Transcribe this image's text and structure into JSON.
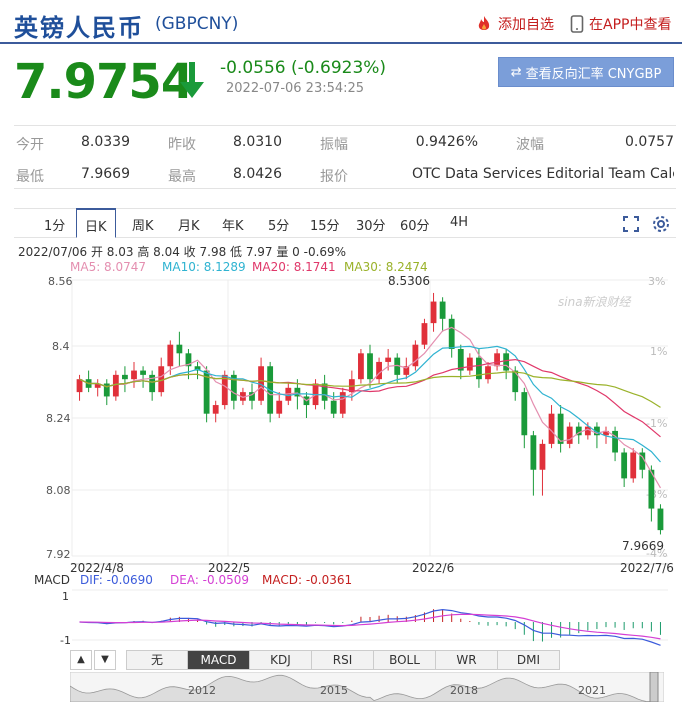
{
  "header": {
    "title": "英镑人民币",
    "code": "(GBPCNY)",
    "add_watch": "添加自选",
    "app_view": "在APP中查看"
  },
  "quote": {
    "price": "7.9754",
    "change": "-0.0556 (-0.6923%)",
    "timestamp": "2022-07-06 23:54:25",
    "reverse_button": "查看反向汇率 CNYGBP"
  },
  "stats": {
    "row1": [
      {
        "label": "今开",
        "value": "8.0339"
      },
      {
        "label": "昨收",
        "value": "8.0310"
      },
      {
        "label": "振幅",
        "value": "0.9426%"
      },
      {
        "label": "波幅",
        "value": "0.0757"
      }
    ],
    "row2": [
      {
        "label": "最低",
        "value": "7.9669"
      },
      {
        "label": "最高",
        "value": "8.0426"
      },
      {
        "label": "报价",
        "value": "OTC Data Services Editorial Team Calc..."
      }
    ]
  },
  "tabs": [
    "1分",
    "日K",
    "周K",
    "月K",
    "年K",
    "5分",
    "15分",
    "30分",
    "60分",
    "4H"
  ],
  "active_tab": "日K",
  "ohlc_line": "2022/07/06 开 8.03 高 8.04 收 7.98 低 7.97 量 0 -0.69%",
  "ma": [
    {
      "label": "MA5: 8.0747",
      "color": "#e48fb0"
    },
    {
      "label": "MA10: 8.1289",
      "color": "#2fb3d1"
    },
    {
      "label": "MA20: 8.1741",
      "color": "#e0386a"
    },
    {
      "label": "MA30: 8.2474",
      "color": "#9ab22a"
    }
  ],
  "watermark": "sina新浪财经",
  "chart_data": {
    "type": "candlestick",
    "y_ticks": [
      "8.56",
      "8.4",
      "8.24",
      "8.08",
      "7.92"
    ],
    "y_pct_ticks": [
      "3%",
      "1%",
      "-1%",
      "-3%",
      "-4%"
    ],
    "x_ticks": [
      "2022/4/8",
      "2022/5",
      "2022/6",
      "2022/7/6"
    ],
    "annotations": {
      "high": "8.5306",
      "low": "7.9669"
    },
    "ylim": [
      7.92,
      8.56
    ],
    "candles": [
      [
        8.3,
        8.33,
        8.28,
        8.34
      ],
      [
        8.33,
        8.31,
        8.3,
        8.35
      ],
      [
        8.31,
        8.32,
        8.29,
        8.33
      ],
      [
        8.32,
        8.29,
        8.27,
        8.33
      ],
      [
        8.29,
        8.34,
        8.28,
        8.35
      ],
      [
        8.34,
        8.33,
        8.3,
        8.36
      ],
      [
        8.33,
        8.35,
        8.31,
        8.37
      ],
      [
        8.35,
        8.34,
        8.31,
        8.36
      ],
      [
        8.34,
        8.3,
        8.28,
        8.35
      ],
      [
        8.3,
        8.36,
        8.29,
        8.38
      ],
      [
        8.36,
        8.41,
        8.34,
        8.42
      ],
      [
        8.41,
        8.39,
        8.36,
        8.44
      ],
      [
        8.39,
        8.36,
        8.33,
        8.4
      ],
      [
        8.36,
        8.35,
        8.33,
        8.37
      ],
      [
        8.35,
        8.25,
        8.23,
        8.36
      ],
      [
        8.25,
        8.27,
        8.23,
        8.28
      ],
      [
        8.27,
        8.34,
        8.26,
        8.35
      ],
      [
        8.34,
        8.28,
        8.26,
        8.35
      ],
      [
        8.28,
        8.3,
        8.27,
        8.31
      ],
      [
        8.3,
        8.28,
        8.26,
        8.32
      ],
      [
        8.28,
        8.36,
        8.27,
        8.38
      ],
      [
        8.36,
        8.25,
        8.23,
        8.37
      ],
      [
        8.25,
        8.28,
        8.24,
        8.3
      ],
      [
        8.28,
        8.31,
        8.27,
        8.32
      ],
      [
        8.31,
        8.29,
        8.26,
        8.33
      ],
      [
        8.29,
        8.27,
        8.24,
        8.3
      ],
      [
        8.27,
        8.32,
        8.26,
        8.33
      ],
      [
        8.32,
        8.28,
        8.26,
        8.34
      ],
      [
        8.28,
        8.25,
        8.24,
        8.3
      ],
      [
        8.25,
        8.3,
        8.24,
        8.31
      ],
      [
        8.3,
        8.33,
        8.28,
        8.35
      ],
      [
        8.33,
        8.39,
        8.32,
        8.4
      ],
      [
        8.39,
        8.33,
        8.31,
        8.41
      ],
      [
        8.33,
        8.37,
        8.32,
        8.38
      ],
      [
        8.37,
        8.38,
        8.35,
        8.4
      ],
      [
        8.38,
        8.34,
        8.32,
        8.39
      ],
      [
        8.34,
        8.36,
        8.33,
        8.38
      ],
      [
        8.36,
        8.41,
        8.35,
        8.42
      ],
      [
        8.41,
        8.46,
        8.4,
        8.47
      ],
      [
        8.46,
        8.51,
        8.44,
        8.53
      ],
      [
        8.51,
        8.47,
        8.44,
        8.52
      ],
      [
        8.47,
        8.4,
        8.38,
        8.48
      ],
      [
        8.4,
        8.35,
        8.33,
        8.41
      ],
      [
        8.35,
        8.38,
        8.34,
        8.39
      ],
      [
        8.38,
        8.33,
        8.31,
        8.4
      ],
      [
        8.33,
        8.36,
        8.32,
        8.37
      ],
      [
        8.36,
        8.39,
        8.35,
        8.4
      ],
      [
        8.39,
        8.35,
        8.33,
        8.4
      ],
      [
        8.35,
        8.3,
        8.28,
        8.36
      ],
      [
        8.3,
        8.2,
        8.17,
        8.31
      ],
      [
        8.2,
        8.12,
        8.06,
        8.21
      ],
      [
        8.12,
        8.18,
        8.06,
        8.19
      ],
      [
        8.18,
        8.25,
        8.17,
        8.27
      ],
      [
        8.25,
        8.18,
        8.16,
        8.27
      ],
      [
        8.18,
        8.22,
        8.17,
        8.23
      ],
      [
        8.22,
        8.2,
        8.18,
        8.23
      ],
      [
        8.2,
        8.22,
        8.19,
        8.23
      ],
      [
        8.22,
        8.2,
        8.17,
        8.23
      ],
      [
        8.2,
        8.21,
        8.18,
        8.22
      ],
      [
        8.21,
        8.16,
        8.14,
        8.22
      ],
      [
        8.16,
        8.1,
        8.08,
        8.17
      ],
      [
        8.1,
        8.16,
        8.09,
        8.17
      ],
      [
        8.16,
        8.12,
        8.1,
        8.17
      ],
      [
        8.12,
        8.03,
        8.0,
        8.13
      ],
      [
        8.03,
        7.98,
        7.97,
        8.04
      ]
    ]
  },
  "macd": {
    "label": "MACD",
    "dif": "DIF: -0.0690",
    "dea": "DEA: -0.0509",
    "macd": "MACD: -0.0361",
    "y_ticks": [
      "1",
      "-1"
    ]
  },
  "indicators": [
    "无",
    "MACD",
    "KDJ",
    "RSI",
    "BOLL",
    "WR",
    "DMI"
  ],
  "active_indicator": "MACD",
  "navigator_years": [
    "2012",
    "2015",
    "2018",
    "2021"
  ],
  "colors": {
    "up": "#e0303a",
    "down": "#1a9a3a",
    "accent": "#3c5b9b"
  }
}
